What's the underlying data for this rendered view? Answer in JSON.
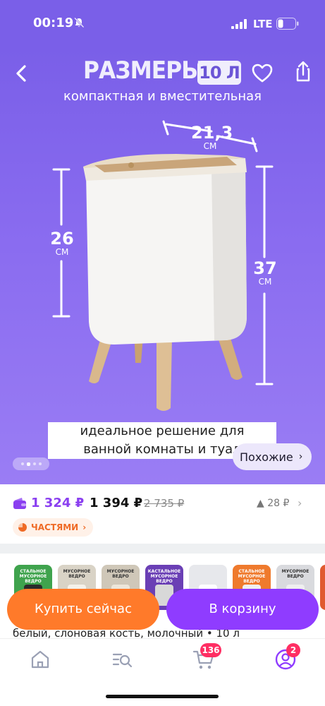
{
  "status_bar": {
    "time": "00:19",
    "network": "LTE"
  },
  "gallery": {
    "title": "РАЗМЕРЫ",
    "title_badge": "10 Л",
    "subtitle": "компактная и вместительная",
    "width_value": "21,3",
    "width_unit": "СМ",
    "leg_height_value": "26",
    "leg_height_unit": "СМ",
    "total_height_value": "37",
    "total_height_unit": "СМ",
    "caption_line1": "идеальное решение для",
    "caption_line2": "ванной комнаты и туал",
    "similar_label": "Похожие",
    "similar_chevron": "›",
    "current_slide": 2,
    "total_slides": 4
  },
  "pricing": {
    "wallet_price": "1 324 ₽",
    "price": "1 394 ₽",
    "old_price": "2 735 ₽",
    "bonus": "▲ 28 ₽",
    "bonus_chevron": "›",
    "installments_label": "ЧАСТЯМИ",
    "installments_chevron": "›"
  },
  "variants": [
    {
      "label": "СТАЛЬНОЕ МУСОРНОЕ ВЕДРО",
      "bg": "#3fa34d",
      "can": "#2b2b2b"
    },
    {
      "label": "МУСОРНОЕ ВЕДРО",
      "bg": "#d9d3c6",
      "can": "#f4f1ea"
    },
    {
      "label": "МУСОРНОЕ ВЕДРО",
      "bg": "#cfc7b8",
      "can": "#ece6da"
    },
    {
      "label": "КАСТАЛЬНОЕ МУСОРНОЕ ВЕДРО",
      "bg": "#6a3fb5",
      "can": "#d8d8d8"
    },
    {
      "label": "",
      "bg": "#e7e8ec",
      "can": "#ffffff"
    },
    {
      "label": "СТАЛЬНОЕ МУСОРНОЕ ВЕДРО",
      "bg": "#ef7a2d",
      "can": "#f0f0f0"
    },
    {
      "label": "МУСОРНОЕ ВЕДРО",
      "bg": "#d9dade",
      "can": "#efefef"
    },
    {
      "label": "",
      "bg": "#e05a2f",
      "can": "#f0f0f0"
    }
  ],
  "actions": {
    "buy_now": "Купить сейчас",
    "add_to_cart": "В корзину"
  },
  "description_peek": "белый, слоновая кость, молочный • 10 л",
  "bottom_nav": {
    "items": [
      {
        "icon": "home-icon"
      },
      {
        "icon": "catalog-search-icon"
      },
      {
        "icon": "cart-icon",
        "badge": "136"
      },
      {
        "icon": "profile-icon",
        "badge": "2"
      }
    ]
  },
  "colors": {
    "brand_purple": "#8f3cff",
    "hero_purple": "#7a5fe8",
    "orange": "#ff7a2a",
    "badge_red": "#ff2e63"
  }
}
